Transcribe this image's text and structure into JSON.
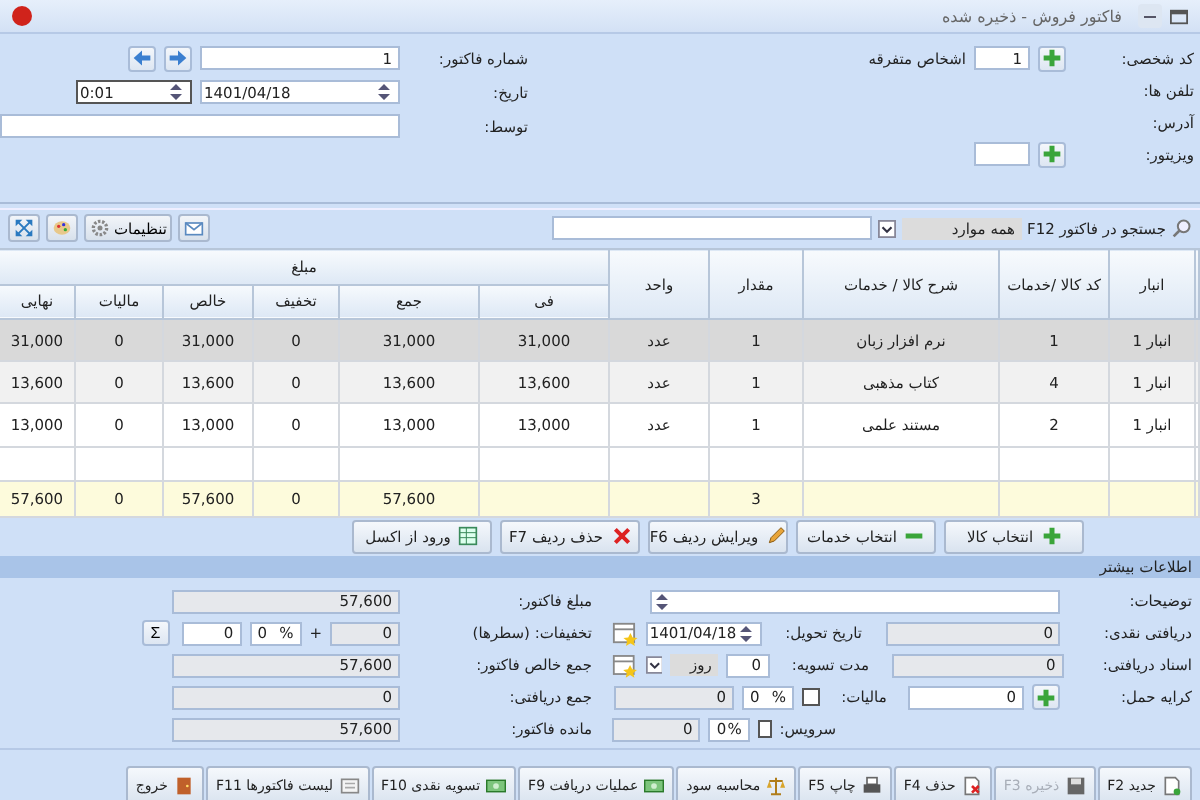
{
  "window": {
    "title": "فاکتور فروش - ذخیره شده"
  },
  "header": {
    "person_code_label": "کد شخصی:",
    "person_code": "1",
    "person_name": "اشخاص متفرقه",
    "phones_label": "تلفن ها:",
    "address_label": "آدرس:",
    "visitor_label": "ویزیتور:",
    "invoice_number_label": "شماره فاکتور:",
    "invoice_number": "1",
    "date_label": "تاریخ:",
    "date": "1401/04/18",
    "time": "0:01",
    "by_label": "توسط:"
  },
  "toolbar": {
    "search_label": "جستجو در فاکتور F12",
    "filter": "همه موارد",
    "settings": "تنظیمات"
  },
  "table": {
    "columns": [
      "انبار",
      "کد کالا /خدمات",
      "شرح کالا / خدمات",
      "مقدار",
      "واحد"
    ],
    "amount_group": "مبلغ",
    "amount_columns": [
      "فی",
      "جمع",
      "تخفیف",
      "خالص",
      "مالیات",
      "نهایی"
    ],
    "rows": [
      {
        "selected": true,
        "cells": [
          "انبار 1",
          "1",
          "نرم افزار زبان",
          "1",
          "عدد",
          "31,000",
          "31,000",
          "0",
          "31,000",
          "0",
          "31,000"
        ]
      },
      {
        "selected": false,
        "cells": [
          "انبار 1",
          "4",
          "کتاب مذهبی",
          "1",
          "عدد",
          "13,600",
          "13,600",
          "0",
          "13,600",
          "0",
          "13,600"
        ]
      },
      {
        "selected": false,
        "cells": [
          "انبار 1",
          "2",
          "مستند علمی",
          "1",
          "عدد",
          "13,000",
          "13,000",
          "0",
          "13,000",
          "0",
          "13,000"
        ]
      }
    ],
    "totals": {
      "quantity": "3",
      "sum": "57,600",
      "discount": "0",
      "net": "57,600",
      "tax": "0",
      "final": "57,600"
    }
  },
  "row_actions": [
    "انتخاب کالا",
    "انتخاب خدمات",
    "ویرایش ردیف F6",
    "حذف ردیف F7",
    "ورود از اکسل"
  ],
  "more_info": {
    "title": "اطلاعات بیشتر",
    "notes_label": "توضیحات:",
    "cash_label": "دریافتی نقدی:",
    "cash": "0",
    "docs_label": "اسناد دریافتی:",
    "docs": "0",
    "freight_label": "کرایه حمل:",
    "freight": "0",
    "delivery_label": "تاریخ تحویل:",
    "delivery": "1401/04/18",
    "settle_label": "مدت تسویه:",
    "settle": "0",
    "settle_unit": "روز",
    "tax": {
      "label": "مالیات:",
      "checked": false,
      "percent": "0",
      "percent_sign": "%",
      "amount": "0"
    },
    "service": {
      "label": "سرویس:",
      "checked": false,
      "percent": "0",
      "percent_sign": "%",
      "amount": "0"
    }
  },
  "summary": {
    "invoice_amount_label": "مبلغ فاکتور:",
    "invoice_amount": "57,600",
    "discounts_label": "تخفیفات: (سطرها)",
    "discounts": "0",
    "plus": "+",
    "discount_percent": "0",
    "percent_sign": "%",
    "discount_extra": "0",
    "sigma": "Σ",
    "net_label": "جمع خالص فاکتور:",
    "net": "57,600",
    "received_label": "جمع دریافتی:",
    "received": "0",
    "remaining_label": "مانده فاکتور:",
    "remaining": "57,600"
  },
  "buttons": [
    {
      "label": "جدید F2",
      "disabled": false
    },
    {
      "label": "ذخیره F3",
      "disabled": true
    },
    {
      "label": "حذف F4",
      "disabled": false
    },
    {
      "label": "چاپ F5",
      "disabled": false
    },
    {
      "label": "محاسبه سود",
      "disabled": false
    },
    {
      "label": "عملیات دریافت F9",
      "disabled": false
    },
    {
      "label": "تسویه نقدی F10",
      "disabled": false
    },
    {
      "label": "لیست فاکتورها F11",
      "disabled": false
    },
    {
      "label": "خروج",
      "disabled": false
    }
  ]
}
